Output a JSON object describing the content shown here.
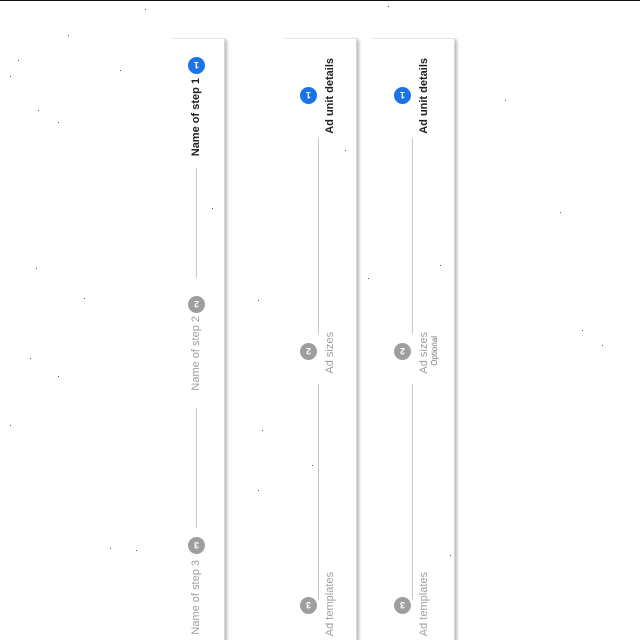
{
  "steppers": [
    {
      "steps": [
        {
          "number": "1",
          "label": "Name of step 1",
          "state": "active"
        },
        {
          "number": "2",
          "label": "Name of step 2",
          "state": "inactive"
        },
        {
          "number": "3",
          "label": "Name of step 3",
          "state": "inactive"
        }
      ]
    },
    {
      "steps": [
        {
          "number": "1",
          "label": "Ad unit details",
          "state": "active"
        },
        {
          "number": "2",
          "label": "Ad sizes",
          "state": "inactive"
        },
        {
          "number": "3",
          "label": "Ad templates",
          "state": "inactive"
        }
      ]
    },
    {
      "steps": [
        {
          "number": "1",
          "label": "Ad unit details",
          "state": "active"
        },
        {
          "number": "2",
          "label": "Ad sizes",
          "sublabel": "Optional",
          "state": "inactive"
        },
        {
          "number": "3",
          "label": "Ad templates",
          "state": "inactive"
        }
      ]
    }
  ],
  "colors": {
    "active": "#1a73e8",
    "inactive": "#9e9e9e",
    "active_text": "#202124"
  }
}
